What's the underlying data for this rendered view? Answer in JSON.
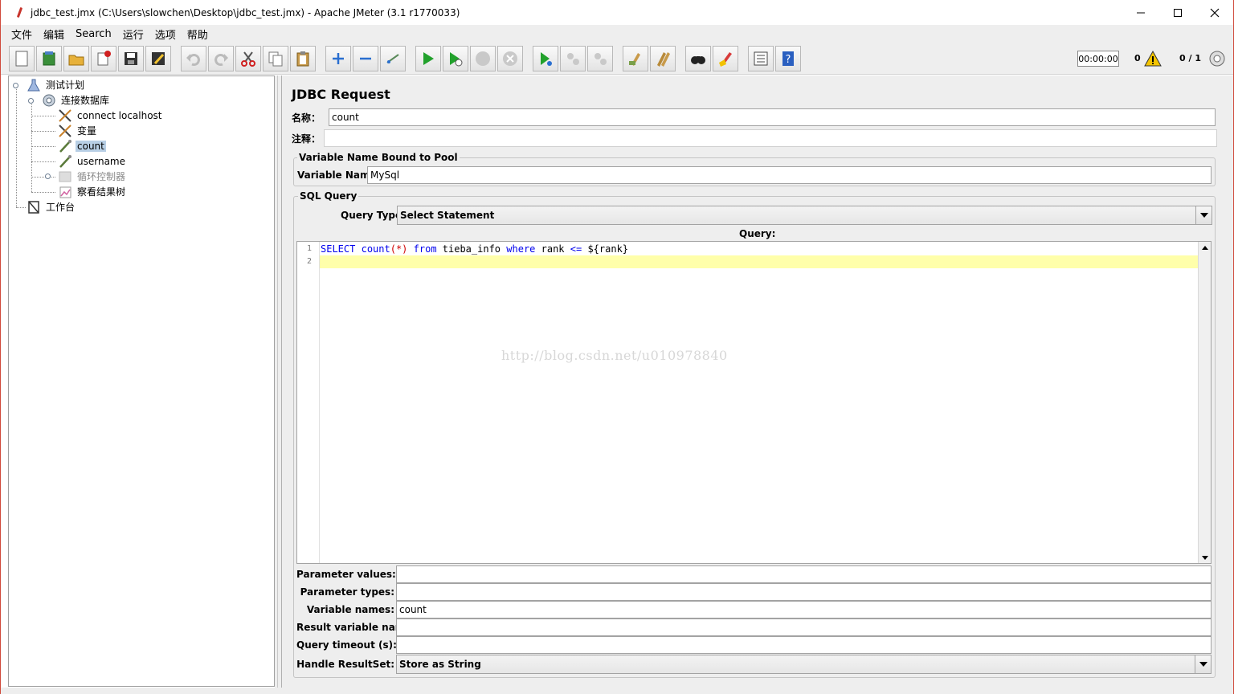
{
  "window": {
    "title": "jdbc_test.jmx (C:\\Users\\slowchen\\Desktop\\jdbc_test.jmx) - Apache JMeter (3.1 r1770033)",
    "minimize": "—",
    "maximize": "☐",
    "close": "✕"
  },
  "menu": [
    "文件",
    "编辑",
    "Search",
    "运行",
    "选项",
    "帮助"
  ],
  "toolbar": {
    "timer": "00:00:00",
    "warnings": "0",
    "threads": "0 / 1",
    "buttons": [
      "new-icon",
      "templates-icon",
      "open-icon",
      "close-icon",
      "save-icon",
      "save-as-icon",
      "undo-icon",
      "redo-icon",
      "cut-icon",
      "copy-icon",
      "paste-icon",
      "expand-icon",
      "collapse-icon",
      "toggle-icon",
      "start-icon",
      "start-no-pause-icon",
      "stop-icon",
      "shutdown-icon",
      "remote-start-icon",
      "remote-stop-icon",
      "remote-shutdown-icon",
      "clear-icon",
      "clear-all-icon",
      "search-icon",
      "reset-search-icon",
      "function-helper-icon",
      "help-icon"
    ]
  },
  "tree": {
    "items": [
      {
        "label": "测试计划",
        "icon": "test-plan-icon"
      },
      {
        "label": "连接数据库",
        "icon": "thread-group-icon"
      },
      {
        "label": "connect localhost",
        "icon": "config-element-icon"
      },
      {
        "label": "变量",
        "icon": "config-element-icon"
      },
      {
        "label": "count",
        "icon": "sampler-icon"
      },
      {
        "label": "username",
        "icon": "sampler-icon"
      },
      {
        "label": "循环控制器",
        "icon": "controller-icon"
      },
      {
        "label": "察看结果树",
        "icon": "listener-icon"
      },
      {
        "label": "工作台",
        "icon": "workbench-icon"
      }
    ]
  },
  "form": {
    "title": "JDBC Request",
    "name_label": "名称：",
    "name_value": "count",
    "comment_label": "注释：",
    "comment_value": "",
    "pool_group": "Variable Name Bound to Pool",
    "var_name_label": "Variable Name:",
    "var_name_value": "MySql",
    "sql_group": "SQL Query",
    "query_type_label": "Query Type:",
    "query_type_value": "Select Statement",
    "query_label": "Query:",
    "code": {
      "line1_no": "1",
      "line2_no": "2",
      "t1": "SELECT",
      "t2": "count",
      "t3": "(*)",
      "t4": "from",
      "t5": "tieba_info",
      "t6": "where",
      "t7": "rank",
      "t8": "<=",
      "t9": "${rank}"
    },
    "param_values_label": "Parameter values:",
    "param_values": "",
    "param_types_label": "Parameter types:",
    "param_types": "",
    "var_names_label": "Variable names:",
    "var_names": "count",
    "result_var_label": "Result variable name:",
    "result_var": "",
    "timeout_label": "Query timeout (s):",
    "timeout": "",
    "handle_rs_label": "Handle ResultSet:",
    "handle_rs_value": "Store as String"
  },
  "watermark": "http://blog.csdn.net/u010978840"
}
